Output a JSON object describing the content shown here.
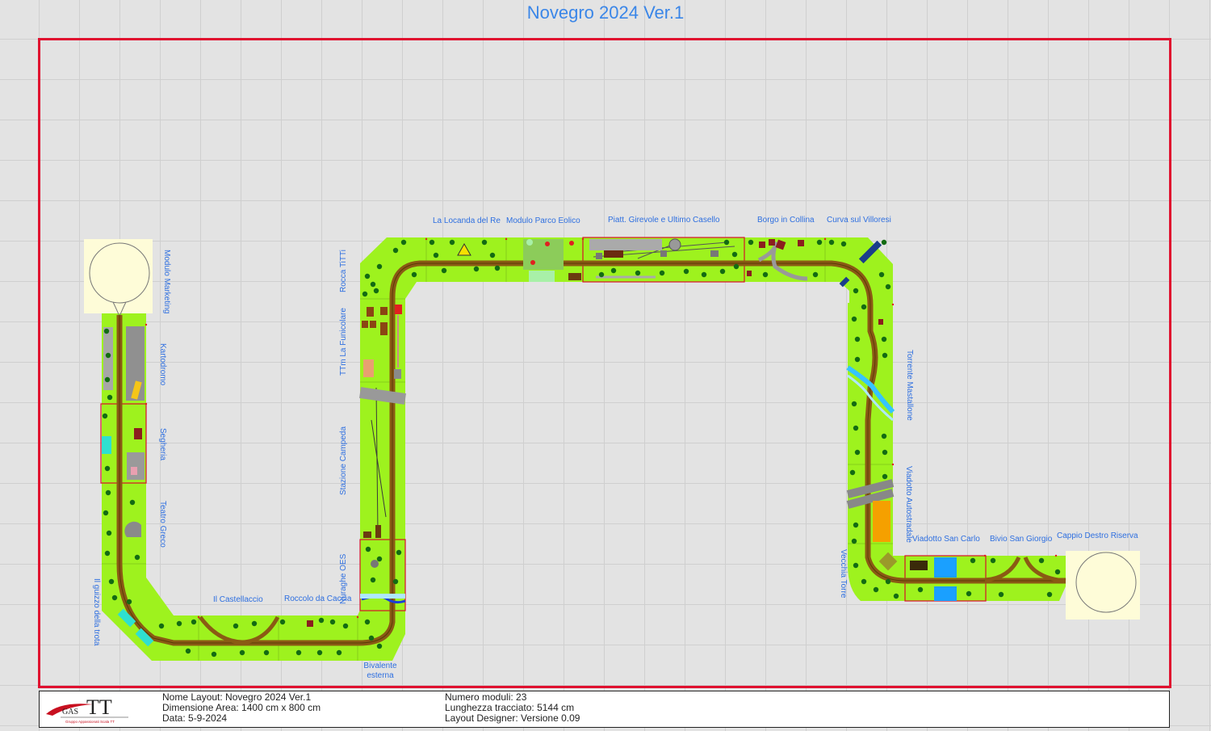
{
  "title": "Novegro 2024 Ver.1",
  "colors": {
    "grass": "#9ef21e",
    "track": "#8a5a14",
    "rail": "#5a3a08",
    "frame": "#e0102f",
    "label": "#2e6fe0",
    "loop_bg": "#fefcd8"
  },
  "modules": {
    "marketing": "Modulo Marketing",
    "kartodromo": "Kartodromo",
    "segheria": "Segheria",
    "teatro": "Teatro Greco",
    "guizzo": "Il guizzo della trota",
    "castellaccio": "Il Castellaccio",
    "roccolo": "Roccolo da Caccia",
    "nuraghe": "Nuraghe OES",
    "bivalente": "Bivalente esterna",
    "campeda": "Stazione Campeda",
    "funicolare": "TTm La Funicolare",
    "rocca": "Rocca TiTTi",
    "locanda": "La Locanda del Re",
    "eolico": "Modulo Parco Eolico",
    "piattaforma": "Piatt. Girevole e Ultimo Casello",
    "borgo": "Borgo in Collina",
    "villoresi": "Curva sul Villoresi",
    "mastallone": "Torrente Mastallone",
    "autostradale": "Viadotto Autostradale",
    "vecchia_torre": "Vecchia Torre",
    "san_carlo": "Viadotto San Carlo",
    "san_giorgio": "Bivio San Giorgio",
    "cappio": "Cappio Destro Riserva"
  },
  "info": {
    "logo_text": "GAS TT",
    "logo_subtitle": "Gruppo Appassionati Scala TT",
    "nome_layout": "Nome Layout: Novegro 2024 Ver.1",
    "dimensione": "Dimensione Area: 1400 cm x 800 cm",
    "data": "Data: 5-9-2024",
    "numero_moduli": "Numero moduli: 23",
    "lunghezza": "Lunghezza tracciato: 5144 cm",
    "designer": "Layout Designer: Versione 0.09"
  }
}
